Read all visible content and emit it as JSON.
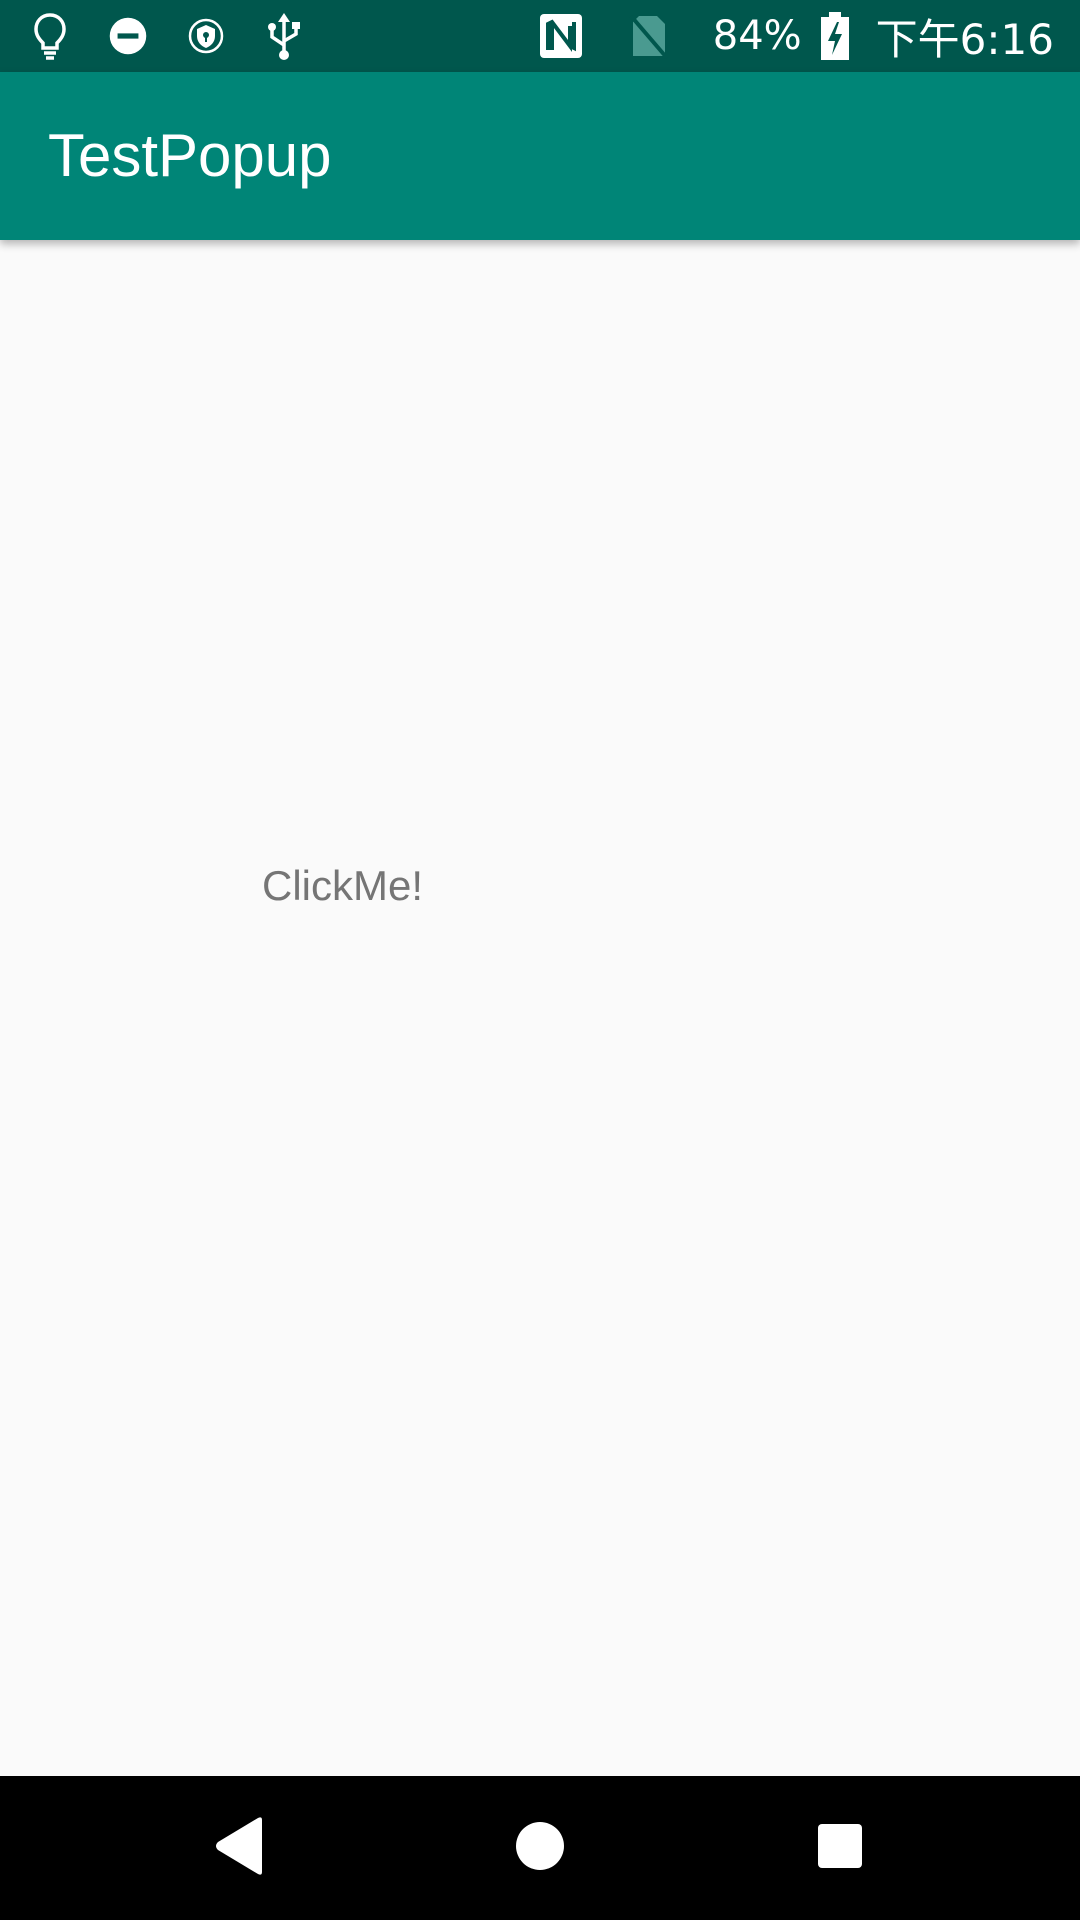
{
  "status_bar": {
    "left_icons": [
      "lightbulb-icon",
      "do-not-disturb-icon",
      "vpn-shield-icon",
      "usb-icon"
    ],
    "right_icons": [
      "nfc-icon",
      "no-sim-icon",
      "battery-charging-icon"
    ],
    "battery_percent": "84%",
    "battery_level": 0.84,
    "time": "下午6:16",
    "background_color": "#00574d"
  },
  "app_bar": {
    "title": "TestPopup",
    "background_color": "#008577"
  },
  "main": {
    "click_me_label": "ClickMe!",
    "text_color": "#757575",
    "background_color": "#fafafa"
  },
  "nav_bar": {
    "buttons": [
      "back-icon",
      "home-icon",
      "recents-icon"
    ],
    "background_color": "#000000"
  }
}
